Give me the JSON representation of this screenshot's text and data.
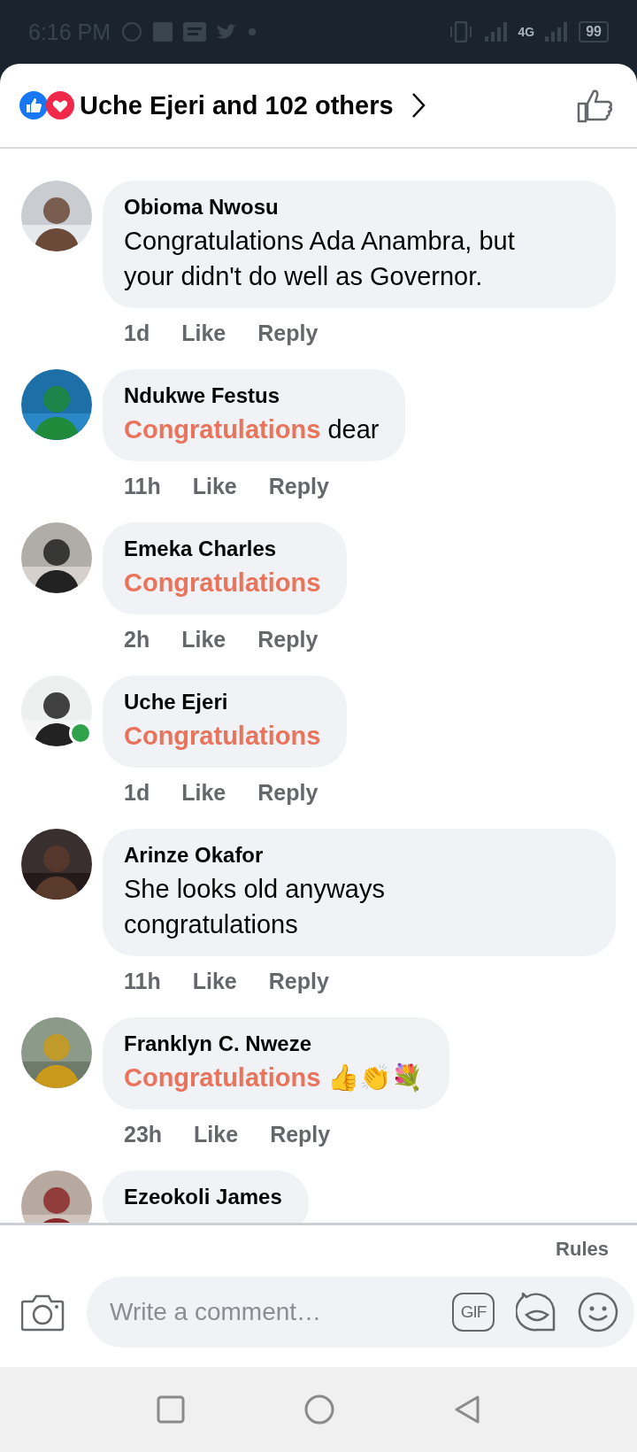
{
  "status_bar": {
    "time": "6:16 PM",
    "battery": "99",
    "network": "4G"
  },
  "header": {
    "reactions_summary": "Uche Ejeri and 102 others"
  },
  "comments": [
    {
      "author": "Obioma Nwosu",
      "text": "Congratulations Ada Anambra, but your didn't do well as Governor.",
      "time": "1d",
      "like": "Like",
      "reply": "Reply",
      "online": false
    },
    {
      "author": "Ndukwe Festus",
      "mention": "Congratulations",
      "text": "dear",
      "time": "11h",
      "like": "Like",
      "reply": "Reply",
      "online": false
    },
    {
      "author": "Emeka Charles",
      "mention": "Congratulations",
      "time": "2h",
      "like": "Like",
      "reply": "Reply",
      "online": false
    },
    {
      "author": "Uche Ejeri",
      "mention": "Congratulations",
      "time": "1d",
      "like": "Like",
      "reply": "Reply",
      "online": true
    },
    {
      "author": "Arinze Okafor",
      "text": "She looks old anyways congratulations",
      "time": "11h",
      "like": "Like",
      "reply": "Reply",
      "online": false
    },
    {
      "author": "Franklyn C. Nweze",
      "mention": "Congratulations",
      "text": "👍👏💐",
      "time": "23h",
      "like": "Like",
      "reply": "Reply",
      "online": false
    },
    {
      "author": "Ezeokoli James",
      "online": false
    }
  ],
  "composer": {
    "rules": "Rules",
    "placeholder": "Write a comment…",
    "gif": "GIF"
  }
}
